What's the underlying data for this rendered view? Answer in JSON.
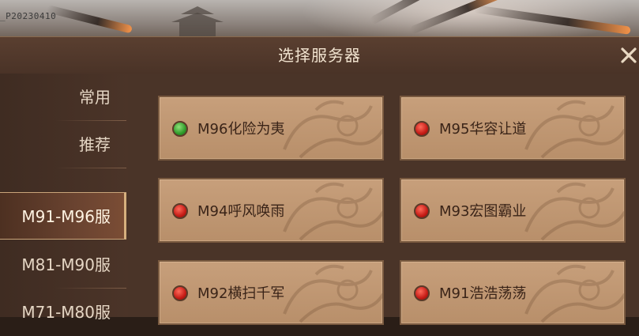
{
  "version_tag": "_P20230410",
  "dialog": {
    "title": "选择服务器",
    "close_icon": "close-x-icon"
  },
  "tabs": [
    {
      "label": "常用",
      "active": false
    },
    {
      "label": "推荐",
      "active": false
    },
    {
      "label": "M91-M96服",
      "active": true
    },
    {
      "label": "M81-M90服",
      "active": false
    },
    {
      "label": "M71-M80服",
      "active": false
    }
  ],
  "servers": [
    {
      "name": "M96化险为夷",
      "status": "green"
    },
    {
      "name": "M95华容让道",
      "status": "red"
    },
    {
      "name": "M94呼风唤雨",
      "status": "red"
    },
    {
      "name": "M93宏图霸业",
      "status": "red"
    },
    {
      "name": "M92横扫千军",
      "status": "red"
    },
    {
      "name": "M91浩浩荡荡",
      "status": "red"
    }
  ],
  "colors": {
    "status_green": "#2f9b2a",
    "status_red": "#c51c16",
    "card_bg": "#c79f7b",
    "panel_bg": "#4a3428"
  }
}
